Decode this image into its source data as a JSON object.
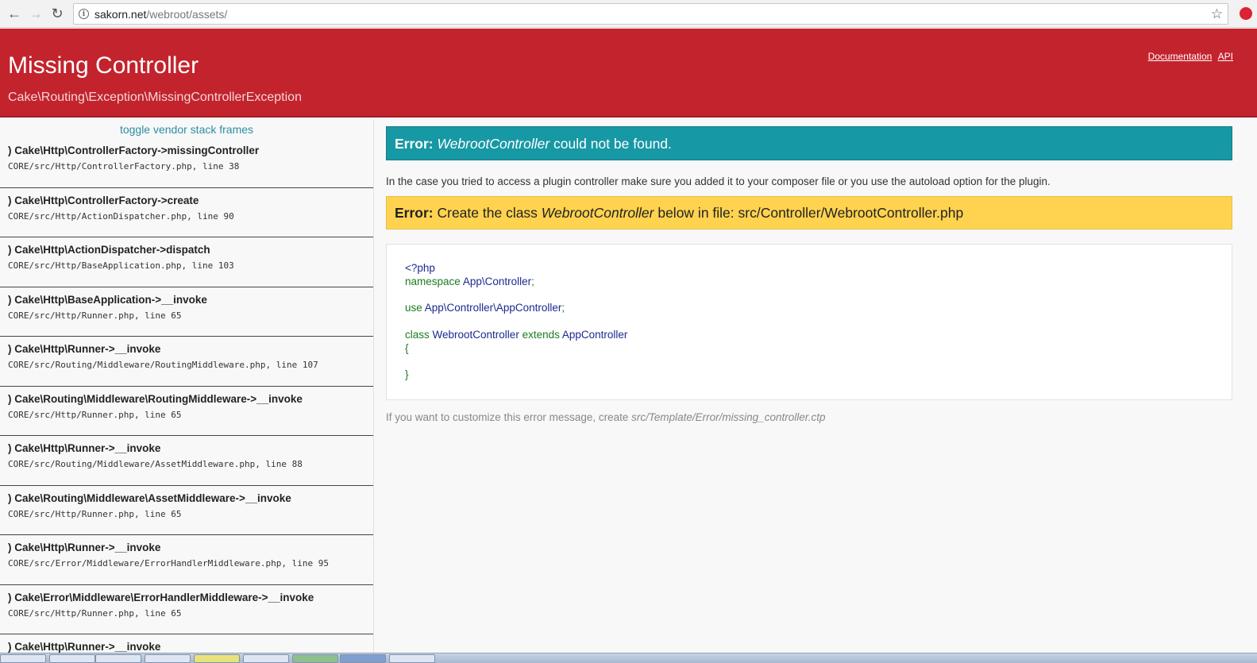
{
  "browser": {
    "url_host": "sakorn.net",
    "url_path": "/webroot/assets/",
    "back_icon": "arrow-left-icon",
    "forward_icon": "arrow-right-icon",
    "reload_icon": "reload-icon",
    "bookmark_icon": "star-icon"
  },
  "header": {
    "title": "Missing Controller",
    "subtitle": "Cake\\Routing\\Exception\\MissingControllerException",
    "link_documentation": "Documentation",
    "link_api": "API",
    "bg_color": "#c3232d"
  },
  "sidebar": {
    "toggle_label": "toggle vendor stack frames",
    "frames": [
      {
        "fn": ") Cake\\Http\\ControllerFactory->missingController",
        "file": "CORE/src/Http/ControllerFactory.php, line 38"
      },
      {
        "fn": ") Cake\\Http\\ControllerFactory->create",
        "file": "CORE/src/Http/ActionDispatcher.php, line 90"
      },
      {
        "fn": ") Cake\\Http\\ActionDispatcher->dispatch",
        "file": "CORE/src/Http/BaseApplication.php, line 103"
      },
      {
        "fn": ") Cake\\Http\\BaseApplication->__invoke",
        "file": "CORE/src/Http/Runner.php, line 65"
      },
      {
        "fn": ") Cake\\Http\\Runner->__invoke",
        "file": "CORE/src/Routing/Middleware/RoutingMiddleware.php, line 107"
      },
      {
        "fn": ") Cake\\Routing\\Middleware\\RoutingMiddleware->__invoke",
        "file": "CORE/src/Http/Runner.php, line 65"
      },
      {
        "fn": ") Cake\\Http\\Runner->__invoke",
        "file": "CORE/src/Routing/Middleware/AssetMiddleware.php, line 88"
      },
      {
        "fn": ") Cake\\Routing\\Middleware\\AssetMiddleware->__invoke",
        "file": "CORE/src/Http/Runner.php, line 65"
      },
      {
        "fn": ") Cake\\Http\\Runner->__invoke",
        "file": "CORE/src/Error/Middleware/ErrorHandlerMiddleware.php, line 95"
      },
      {
        "fn": ") Cake\\Error\\Middleware\\ErrorHandlerMiddleware->__invoke",
        "file": "CORE/src/Http/Runner.php, line 65"
      },
      {
        "fn": ") Cake\\Http\\Runner->__invoke",
        "file": ""
      }
    ]
  },
  "main": {
    "error_label": "Error:",
    "error_class": "WebrootController",
    "error_msg": " could not be found.",
    "description": "In the case you tried to access a plugin controller make sure you added it to your composer file or you use the autoload option for the plugin.",
    "warn_label": "Error:",
    "warn_prefix": " Create the class ",
    "warn_class": "WebrootController",
    "warn_suffix": " below in file: src/Controller/WebrootController.php",
    "code": {
      "php_open": "<?php",
      "namespace_kw": "namespace ",
      "namespace_name": "App\\Controller",
      "semicolon": ";",
      "use_kw": "use ",
      "use_name": "App\\Controller\\AppController",
      "class_kw": "class ",
      "class_name": "WebrootController",
      "extends_kw": " extends ",
      "extends_name": "AppController",
      "brace_open": "{",
      "brace_close": "}"
    },
    "note_prefix": "If you want to customize this error message, create ",
    "note_path": "src/Template/Error/missing_controller.ctp",
    "info_color": "#1798a5",
    "warn_color": "#ffd34f"
  }
}
